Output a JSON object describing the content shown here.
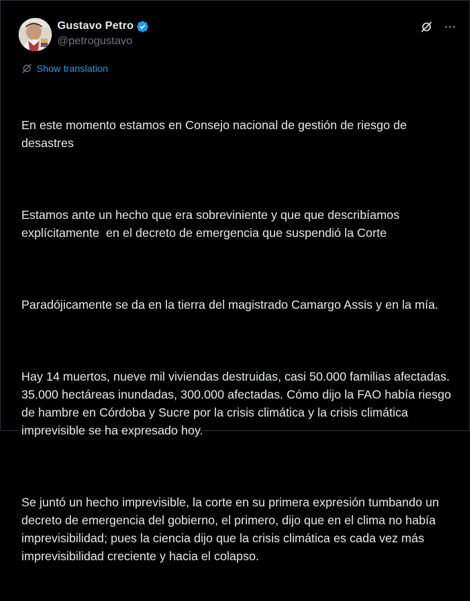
{
  "post": {
    "author": {
      "display_name": "Gustavo Petro",
      "handle": "@petrogustavo",
      "verified": true,
      "avatar_icon": "profile-photo"
    },
    "header_icons": [
      "grok-icon",
      "more-icon"
    ],
    "translate_label": "Show translation",
    "paragraphs": [
      "En este momento estamos en Consejo nacional de gestión de riesgo de desastres",
      "Estamos ante un hecho que era sobreviniente y que que describíamos explícitamente  en el decreto de emergencia que suspendió la Corte",
      "Paradójicamente se da en la tierra del magistrado Camargo Assis y en la mía.",
      "Hay 14 muertos, nueve mil viviendas destruidas, casi 50.000 familias afectadas. 35.000 hectáreas inundadas, 300.000 afectadas. Cómo dijo la FAO había riesgo de hambre en Córdoba y Sucre por la crisis climática y la crisis climática imprevisible se ha expresado hoy.",
      "Se juntó un hecho imprevisible, la corte en su primera expresión tumbando un decreto de emergencia del gobierno, el primero, dijo que en el clima no había imprevisibilidad; pues la ciencia dijo que la crisis climática es cada vez más imprevisibilidad creciente y hacia el colapso."
    ]
  },
  "colors": {
    "background": "#000000",
    "text": "#e7e9ea",
    "secondary_text": "#71767b",
    "link": "#1d9bf0",
    "verified_badge": "#1d9bf0",
    "border": "#2f3336"
  }
}
